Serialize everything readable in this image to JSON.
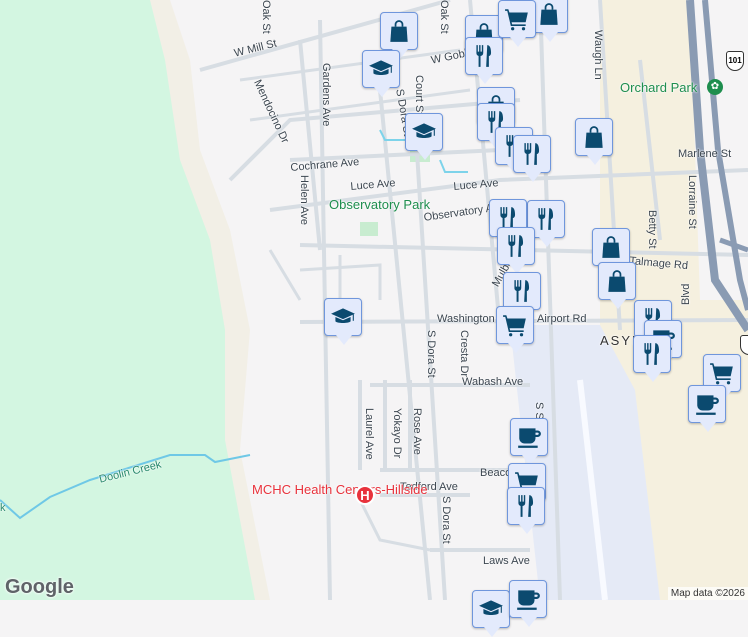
{
  "streets": {
    "oak_st": "Oak St",
    "w_mill_st": "W Mill St",
    "mendocino_dr": "Mendocino Dr",
    "gardens_ave": "Gardens Ave",
    "court_st": "Court St",
    "s_dora_st": "S Dora St",
    "w_gobbi": "W Gobbi",
    "cochrane_ave": "Cochrane Ave",
    "luce_ave": "Luce Ave",
    "observatory_ave": "Observatory A",
    "helen_ave": "Helen Ave",
    "mulberry": "Mulberry",
    "talmage_rd": "Talmage Rd",
    "washington": "Washington",
    "airport_rd": "Airport Rd",
    "cresta_dr": "Cresta Dr",
    "wabash_ave": "Wabash Ave",
    "laurel_ave": "Laurel Ave",
    "yokayo_dr": "Yokayo Dr",
    "rose_ave": "Rose Ave",
    "beacon": "Beaco",
    "tedford_ave": "Tedford Ave",
    "laws_ave": "Laws Ave",
    "waugh_ln": "Waugh Ln",
    "marlene_st": "Marlene St",
    "lorraine_st": "Lorraine St",
    "betty_st": "Betty St",
    "blvd": "Blvd",
    "s_state": "S S",
    "marlene": "Marlene St"
  },
  "places": {
    "observatory_park": "Observatory Park",
    "orchard_park": "Orchard Park",
    "doolin_creek": "Doolin Creek",
    "creek_fragment": "k",
    "hospital": "MCHC Health Centers-Hillside",
    "airport": "ASYL"
  },
  "highway": "101",
  "google_logo": "Google",
  "credit": "Map data ©2026",
  "colors": {
    "marker_bg": "#e3eafc",
    "marker_border": "#6f96dc",
    "icon": "#0b4a6f",
    "park": "#d3f6e1",
    "hospital": "#e8323c"
  }
}
